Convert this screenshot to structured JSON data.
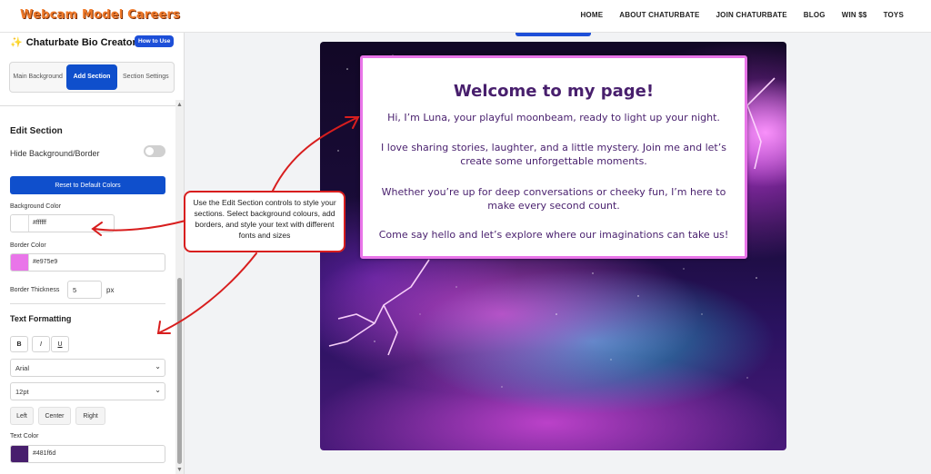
{
  "header": {
    "logo": "Webcam Model Careers",
    "nav": [
      "HOME",
      "ABOUT CHATURBATE",
      "JOIN CHATURBATE",
      "BLOG",
      "WIN $$",
      "TOYS"
    ]
  },
  "panel": {
    "title": "Chaturbate Bio Creator",
    "how_to_label": "How to Use",
    "tabs": [
      "Main Background",
      "Add Section",
      "Section Settings"
    ],
    "edit_section_heading": "Edit Section",
    "hide_background_label": "Hide Background/Border",
    "reset_label": "Reset to Default Colors",
    "background_color_label": "Background Color",
    "background_color_value": "#ffffff",
    "border_color_label": "Border Color",
    "border_color_value": "#e975e9",
    "border_thickness_label": "Border Thickness",
    "border_thickness_value": "5",
    "border_thickness_unit": "px",
    "text_formatting_heading": "Text Formatting",
    "bold_label": "B",
    "italic_label": "I",
    "underline_label": "U",
    "font_family_value": "Arial",
    "font_size_value": "12pt",
    "align_left_label": "Left",
    "align_center_label": "Center",
    "align_right_label": "Right",
    "text_color_label": "Text Color",
    "text_color_value": "#481f6d"
  },
  "callout": {
    "text": "Use the Edit Section controls to style your sections. Select background colours, add borders, and style your text with different fonts and sizes"
  },
  "preview": {
    "title": "Welcome to my page!",
    "paragraphs": [
      "Hi, I’m Luna, your playful moonbeam, ready to light up your night.",
      "I love sharing stories, laughter, and a little mystery. Join me and let’s create some unforgettable moments.",
      "Whether you’re up for deep conversations or cheeky fun, I’m here to make every second count.",
      "Come say hello and let’s explore where our imaginations can take us!"
    ]
  },
  "colors": {
    "accent_blue": "#0f4fcc",
    "annotation_red": "#d81e1e",
    "card_border": "#e975e9",
    "card_text": "#481f6d"
  }
}
